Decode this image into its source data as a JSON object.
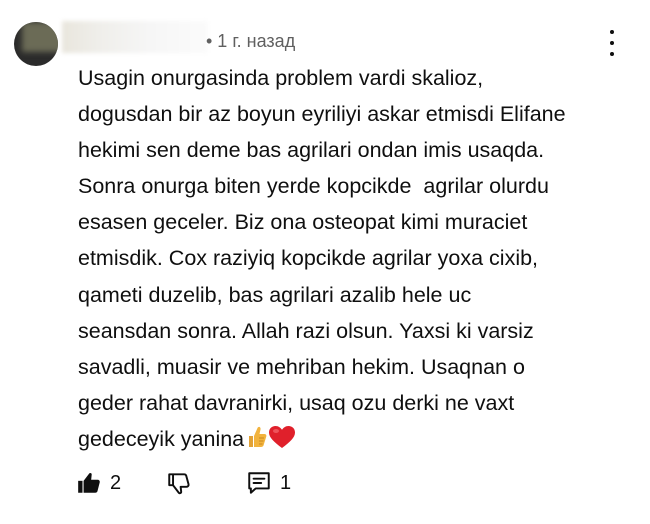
{
  "comment": {
    "meta": "• 1 г. назад",
    "text": "Usagin onurgasinda problem vardi skalioz,\ndogusdan bir az boyun eyriliyi askar etmisdi Elifane\nhekimi sen deme bas agrilari ondan imis usaqda.\nSonra onurga biten yerde kopcikde  agrilar olurdu\nesasen geceler. Biz ona osteopat kimi muraciet\netmisdik. Cox raziyiq kopcikde agrilar yoxa cixib,\nqameti duzelib, bas agrilari azalib hele uc\nseansdan sonra. Allah razi olsun. Yaxsi ki varsiz\nsavadli, muasir ve mehriban hekim. Usaqnan o\ngeder rahat davranirki, usaq ozu derki ne vaxt\ngedeceyik yanina",
    "emojis": "👍❤️",
    "likes": "2",
    "replies": "1"
  },
  "icons": {
    "menu": "more-vertical-icon",
    "like": "thumbs-up-filled-icon",
    "dislike": "thumbs-down-outline-icon",
    "reply": "comment-icon"
  },
  "colors": {
    "text": "#0f0f0f",
    "meta": "#606060",
    "heart": "#e0202b",
    "thumb": "#f2b33d"
  }
}
